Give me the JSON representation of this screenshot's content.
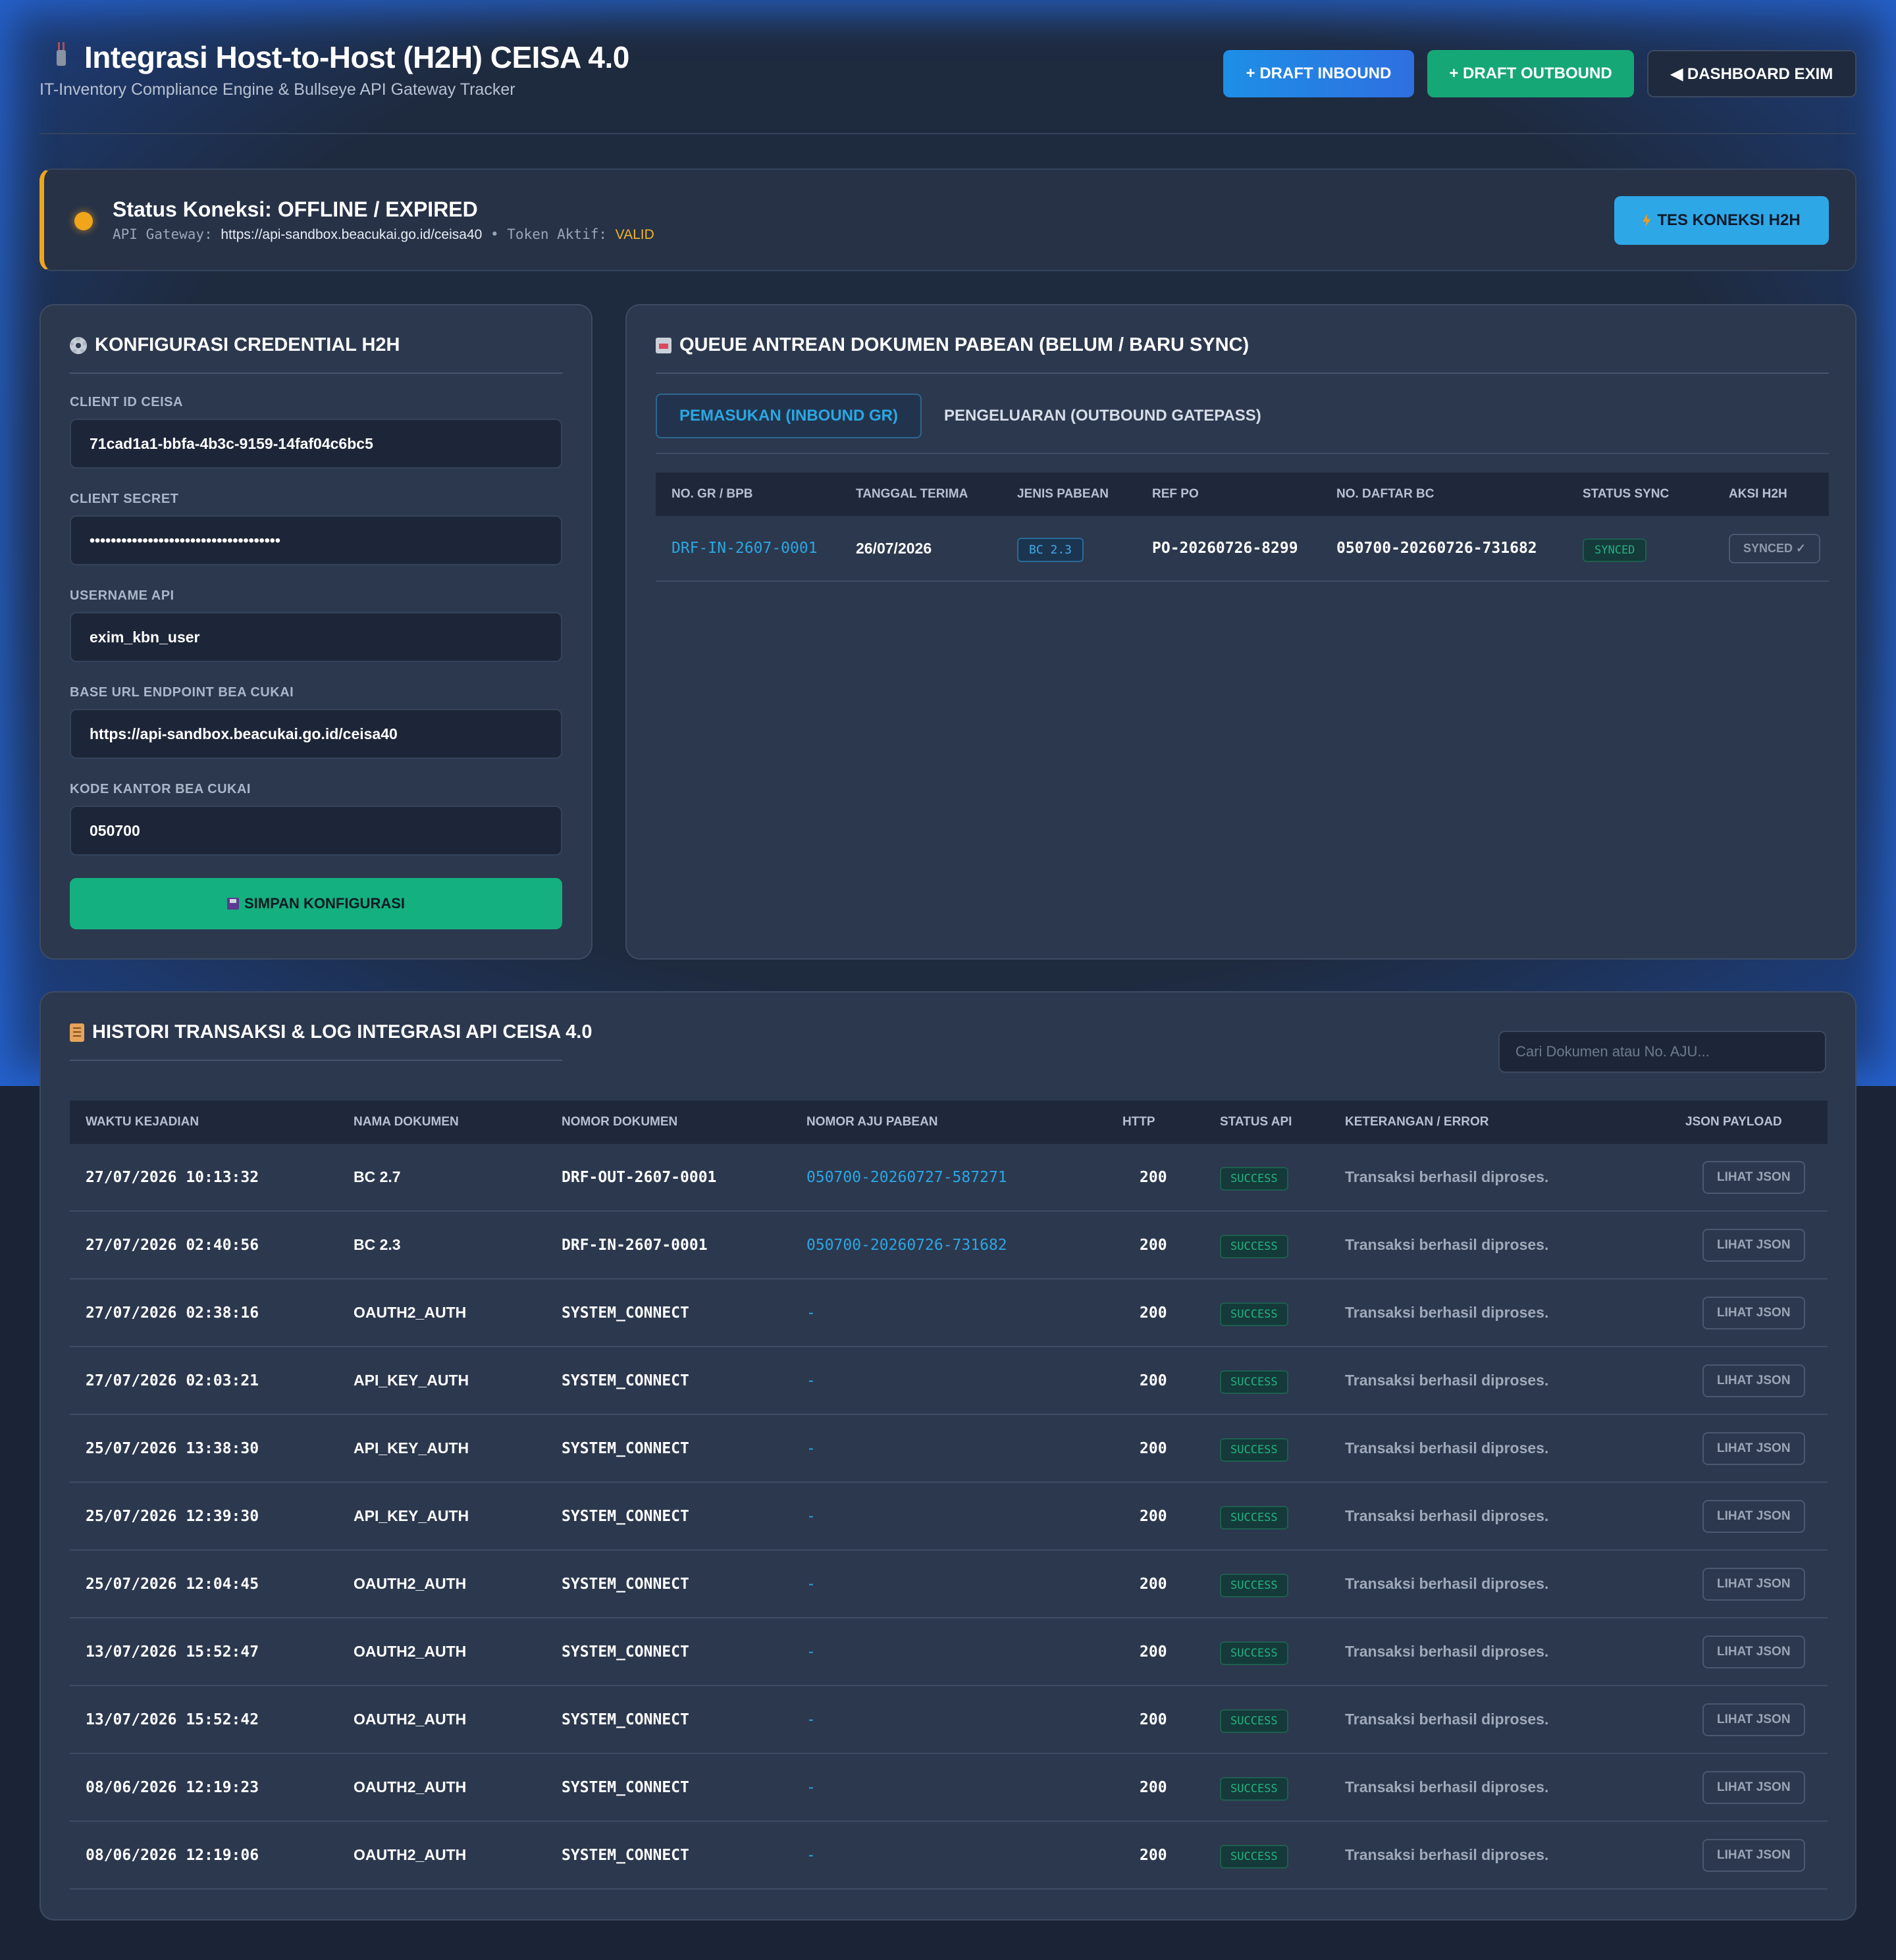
{
  "header": {
    "title": "Integrasi Host-to-Host (H2H) CEISA 4.0",
    "subtitle": "IT-Inventory Compliance Engine & Bullseye API Gateway Tracker",
    "btn_inbound": "+ DRAFT INBOUND",
    "btn_outbound": "+ DRAFT OUTBOUND",
    "btn_dashboard": "◀ DASHBOARD EXIM"
  },
  "status": {
    "title": "Status Koneksi: OFFLINE / EXPIRED",
    "gateway_label": "API Gateway:",
    "gateway_url": "https://api-sandbox.beacukai.go.id/ceisa40",
    "separator": "•",
    "token_label": "Token Aktif:",
    "token_value": "VALID",
    "test_button": "TES KONEKSI H2H",
    "accent_color": "#f1a51b"
  },
  "credential": {
    "title": "KONFIGURASI CREDENTIAL H2H",
    "fields": [
      {
        "label": "CLIENT ID CEISA",
        "value": "71cad1a1-bbfa-4b3c-9159-14faf04c6bc5"
      },
      {
        "label": "CLIENT SECRET",
        "value": "••••••••••••••••••••••••••••••••••••"
      },
      {
        "label": "USERNAME API",
        "value": "exim_kbn_user"
      },
      {
        "label": "BASE URL ENDPOINT BEA CUKAI",
        "value": "https://api-sandbox.beacukai.go.id/ceisa40"
      },
      {
        "label": "KODE KANTOR BEA CUKAI",
        "value": "050700"
      }
    ],
    "save_button": "SIMPAN KONFIGURASI"
  },
  "queue": {
    "title": "QUEUE ANTREAN DOKUMEN PABEAN (BELUM / BARU SYNC)",
    "tabs": [
      {
        "label": "PEMASUKAN (INBOUND GR)",
        "active": true
      },
      {
        "label": "PENGELUARAN (OUTBOUND GATEPASS)",
        "active": false
      }
    ],
    "columns": [
      "NO. GR / BPB",
      "TANGGAL TERIMA",
      "JENIS PABEAN",
      "REF PO",
      "NO. DAFTAR BC",
      "STATUS SYNC",
      "AKSI H2H"
    ],
    "rows": [
      {
        "no_gr": "DRF-IN-2607-0001",
        "tanggal": "26/07/2026",
        "jenis": "BC 2.3",
        "ref_po": "PO-20260726-8299",
        "no_daftar": "050700-20260726-731682",
        "status": "SYNCED",
        "aksi": "SYNCED ✓"
      }
    ]
  },
  "log": {
    "title": "HISTORI TRANSAKSI & LOG INTEGRASI API CEISA 4.0",
    "search_placeholder": "Cari Dokumen atau No. AJU...",
    "columns": [
      "WAKTU KEJADIAN",
      "NAMA DOKUMEN",
      "NOMOR DOKUMEN",
      "NOMOR AJU PABEAN",
      "HTTP",
      "STATUS API",
      "KETERANGAN / ERROR",
      "JSON PAYLOAD"
    ],
    "json_button": "LIHAT JSON",
    "rows": [
      {
        "waktu": "27/07/2026 10:13:32",
        "nama": "BC 2.7",
        "nomor": "DRF-OUT-2607-0001",
        "aju": "050700-20260727-587271",
        "http": "200",
        "status": "SUCCESS",
        "ket": "Transaksi berhasil diproses."
      },
      {
        "waktu": "27/07/2026 02:40:56",
        "nama": "BC 2.3",
        "nomor": "DRF-IN-2607-0001",
        "aju": "050700-20260726-731682",
        "http": "200",
        "status": "SUCCESS",
        "ket": "Transaksi berhasil diproses."
      },
      {
        "waktu": "27/07/2026 02:38:16",
        "nama": "OAUTH2_AUTH",
        "nomor": "SYSTEM_CONNECT",
        "aju": "-",
        "http": "200",
        "status": "SUCCESS",
        "ket": "Transaksi berhasil diproses."
      },
      {
        "waktu": "27/07/2026 02:03:21",
        "nama": "API_KEY_AUTH",
        "nomor": "SYSTEM_CONNECT",
        "aju": "-",
        "http": "200",
        "status": "SUCCESS",
        "ket": "Transaksi berhasil diproses."
      },
      {
        "waktu": "25/07/2026 13:38:30",
        "nama": "API_KEY_AUTH",
        "nomor": "SYSTEM_CONNECT",
        "aju": "-",
        "http": "200",
        "status": "SUCCESS",
        "ket": "Transaksi berhasil diproses."
      },
      {
        "waktu": "25/07/2026 12:39:30",
        "nama": "API_KEY_AUTH",
        "nomor": "SYSTEM_CONNECT",
        "aju": "-",
        "http": "200",
        "status": "SUCCESS",
        "ket": "Transaksi berhasil diproses."
      },
      {
        "waktu": "25/07/2026 12:04:45",
        "nama": "OAUTH2_AUTH",
        "nomor": "SYSTEM_CONNECT",
        "aju": "-",
        "http": "200",
        "status": "SUCCESS",
        "ket": "Transaksi berhasil diproses."
      },
      {
        "waktu": "13/07/2026 15:52:47",
        "nama": "OAUTH2_AUTH",
        "nomor": "SYSTEM_CONNECT",
        "aju": "-",
        "http": "200",
        "status": "SUCCESS",
        "ket": "Transaksi berhasil diproses."
      },
      {
        "waktu": "13/07/2026 15:52:42",
        "nama": "OAUTH2_AUTH",
        "nomor": "SYSTEM_CONNECT",
        "aju": "-",
        "http": "200",
        "status": "SUCCESS",
        "ket": "Transaksi berhasil diproses."
      },
      {
        "waktu": "08/06/2026 12:19:23",
        "nama": "OAUTH2_AUTH",
        "nomor": "SYSTEM_CONNECT",
        "aju": "-",
        "http": "200",
        "status": "SUCCESS",
        "ket": "Transaksi berhasil diproses."
      },
      {
        "waktu": "08/06/2026 12:19:06",
        "nama": "OAUTH2_AUTH",
        "nomor": "SYSTEM_CONNECT",
        "aju": "-",
        "http": "200",
        "status": "SUCCESS",
        "ket": "Transaksi berhasil diproses."
      }
    ]
  },
  "icons": {
    "title": "plug-icon",
    "credential": "gear-icon",
    "queue": "inbox-icon",
    "log": "scroll-icon",
    "test": "bolt-icon",
    "save": "floppy-icon"
  },
  "colors": {
    "background": "#1b2436",
    "panel": "#2c384e",
    "accent_blue": "#2ba7e4",
    "accent_green": "#14b07f",
    "warning": "#f1a51b"
  }
}
